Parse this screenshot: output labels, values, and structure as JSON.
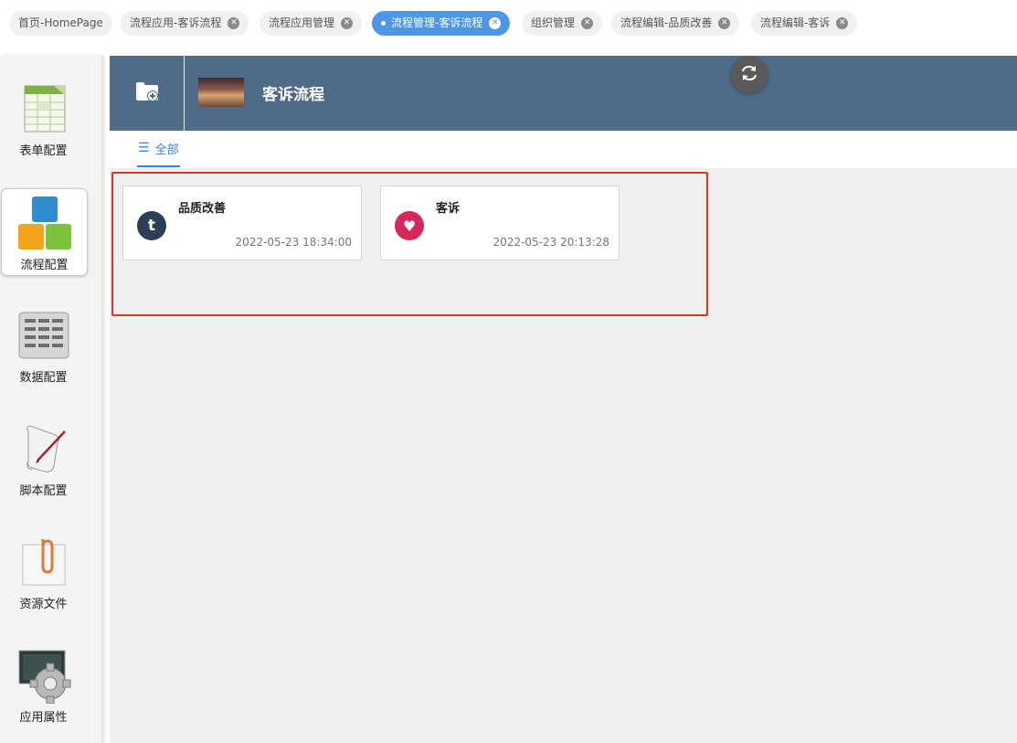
{
  "tabs": [
    {
      "label": "首页-HomePage",
      "closable": false,
      "active": false
    },
    {
      "label": "流程应用-客诉流程",
      "closable": true,
      "active": false
    },
    {
      "label": "流程应用管理",
      "closable": true,
      "active": false
    },
    {
      "label": "流程管理-客诉流程",
      "closable": true,
      "active": true
    },
    {
      "label": "组织管理",
      "closable": true,
      "active": false
    },
    {
      "label": "流程编辑-品质改善",
      "closable": true,
      "active": false
    },
    {
      "label": "流程编辑-客诉",
      "closable": true,
      "active": false
    }
  ],
  "sidebar": {
    "items": [
      {
        "label": "表单配置",
        "icon": "form-spreadsheet-icon"
      },
      {
        "label": "流程配置",
        "icon": "process-blocks-icon",
        "active": true
      },
      {
        "label": "数据配置",
        "icon": "data-grid-icon"
      },
      {
        "label": "脚本配置",
        "icon": "script-scroll-icon"
      },
      {
        "label": "资源文件",
        "icon": "paperclip-file-icon"
      },
      {
        "label": "应用属性",
        "icon": "settings-gear-icon"
      }
    ]
  },
  "header": {
    "title": "客诉流程",
    "new_icon": "folder-plus-icon",
    "refresh_icon": "refresh-icon"
  },
  "filter": {
    "tab_label": "全部"
  },
  "cards": [
    {
      "name": "品质改善",
      "time": "2022-05-23 18:34:00",
      "avatar_letter": "t",
      "avatar_color": "#2d3e57"
    },
    {
      "name": "客诉",
      "time": "2022-05-23 20:13:28",
      "avatar_symbol": "♥",
      "avatar_color": "#d6285a"
    }
  ],
  "colors": {
    "accent": "#4d96e8",
    "header_bg": "#4f6b87",
    "highlight_border": "#e1302a"
  }
}
